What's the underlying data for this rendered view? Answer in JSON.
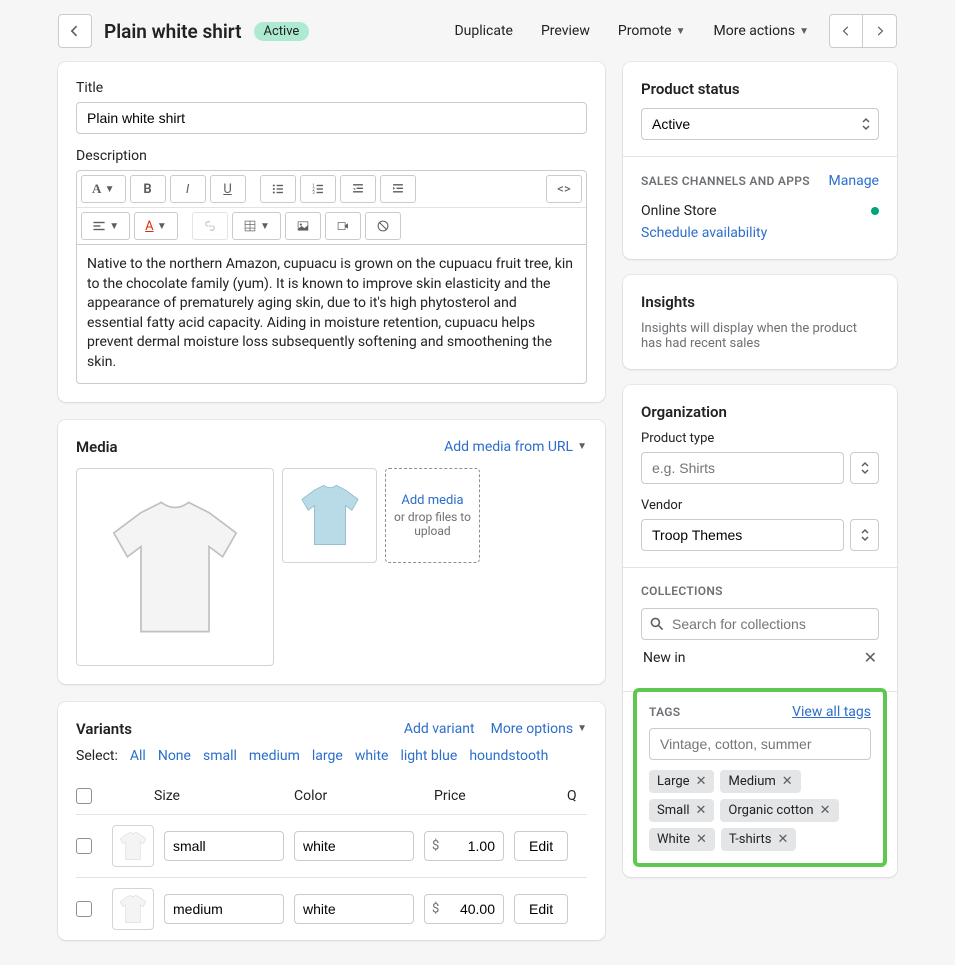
{
  "header": {
    "title": "Plain white shirt",
    "status_badge": "Active",
    "actions": {
      "duplicate": "Duplicate",
      "preview": "Preview",
      "promote": "Promote",
      "more": "More actions"
    }
  },
  "main_card": {
    "title_label": "Title",
    "title_value": "Plain white shirt",
    "description_label": "Description",
    "description_value": "Native to the northern Amazon, cupuacu is grown on the cupuacu fruit tree, kin to the chocolate family (yum). It is known to improve skin elasticity and the appearance of prematurely aging skin, due to it's high phytosterol and essential fatty acid capacity. Aiding in moisture retention, cupuacu helps prevent dermal moisture loss subsequently softening and smoothening the skin.",
    "code_btn": "<>"
  },
  "media": {
    "heading": "Media",
    "add_url": "Add media from URL",
    "add_media": "Add media",
    "drop_text": "or drop files to upload"
  },
  "variants": {
    "heading": "Variants",
    "add_variant": "Add variant",
    "more_options": "More options",
    "select_label": "Select:",
    "filters": [
      "All",
      "None",
      "small",
      "medium",
      "large",
      "white",
      "light blue",
      "houndstooth"
    ],
    "columns": {
      "size": "Size",
      "color": "Color",
      "price": "Price",
      "q": "Q"
    },
    "currency": "$",
    "rows": [
      {
        "size": "small",
        "color": "white",
        "price": "1.00",
        "edit": "Edit"
      },
      {
        "size": "medium",
        "color": "white",
        "price": "40.00",
        "edit": "Edit"
      }
    ]
  },
  "status": {
    "heading": "Product status",
    "value": "Active",
    "channels_label": "SALES CHANNELS AND APPS",
    "manage": "Manage",
    "online_store": "Online Store",
    "schedule": "Schedule availability"
  },
  "insights": {
    "heading": "Insights",
    "text": "Insights will display when the product has had recent sales"
  },
  "organization": {
    "heading": "Organization",
    "type_label": "Product type",
    "type_placeholder": "e.g. Shirts",
    "vendor_label": "Vendor",
    "vendor_value": "Troop Themes",
    "collections_label": "COLLECTIONS",
    "collections_placeholder": "Search for collections",
    "collection_item": "New in"
  },
  "tags": {
    "label": "TAGS",
    "view_all": "View all tags",
    "placeholder": "Vintage, cotton, summer",
    "items": [
      "Large",
      "Medium",
      "Small",
      "Organic cotton",
      "White",
      "T-shirts"
    ]
  }
}
